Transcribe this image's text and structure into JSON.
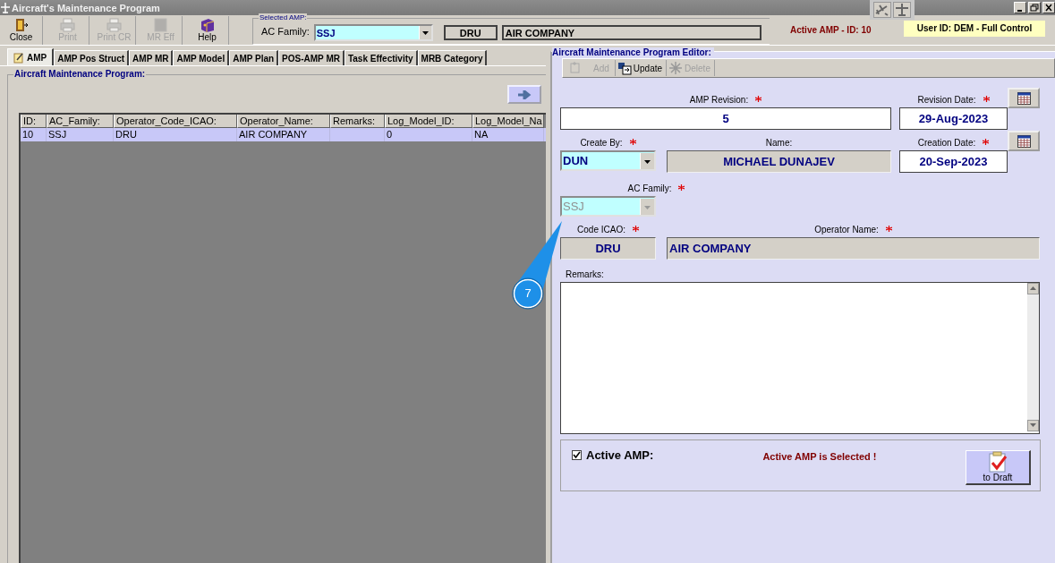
{
  "window": {
    "title": "Aircraft's Maintenance Program"
  },
  "toolbar": [
    {
      "label": "Close",
      "kind": "door",
      "disabled": false
    },
    {
      "label": "Print",
      "kind": "printer",
      "disabled": true
    },
    {
      "label": "Print CR",
      "kind": "printer",
      "disabled": true
    },
    {
      "label": "MR Eff",
      "kind": "square",
      "disabled": true
    },
    {
      "label": "Help",
      "kind": "book",
      "disabled": false
    }
  ],
  "selected_amp": {
    "title": "Selected AMP:",
    "ac_family_label": "AC Family:",
    "ac_family": "SSJ",
    "operator_code": "DRU",
    "operator_name": "AIR COMPANY"
  },
  "active_amp": "Active AMP - ID: 10",
  "user": "User ID: DEM - Full Control",
  "tabs": [
    {
      "label": "AMP",
      "selected": true
    },
    {
      "label": "AMP Pos Struct",
      "selected": false
    },
    {
      "label": "AMP MR",
      "selected": false
    },
    {
      "label": "AMP Model",
      "selected": false
    },
    {
      "label": "AMP Plan",
      "selected": false
    },
    {
      "label": "POS-AMP MR",
      "selected": false
    },
    {
      "label": "Task Effectivity",
      "selected": false
    },
    {
      "label": "MRB Category",
      "selected": false
    }
  ],
  "left_panel": {
    "title": "Aircraft Maintenance Program:",
    "table": {
      "columns": [
        "ID:",
        "AC_Family:",
        "Operator_Code_ICAO:",
        "Operator_Name:",
        "Remarks:",
        "Log_Model_ID:",
        "Log_Model_Na"
      ],
      "rows": [
        {
          "selected": true,
          "cells": [
            "10",
            "SSJ",
            "DRU",
            "AIR COMPANY",
            "",
            "0",
            "NA"
          ]
        }
      ]
    }
  },
  "editor": {
    "title": "Aircraft Maintenance Program Editor:",
    "actions": [
      {
        "label": "Add",
        "kind": "add",
        "disabled": true
      },
      {
        "label": "Update",
        "kind": "update",
        "disabled": false
      },
      {
        "label": "Delete",
        "kind": "delete",
        "disabled": true
      }
    ],
    "amp_revision": {
      "label": "AMP Revision:",
      "required": true,
      "value": "5"
    },
    "revision_date": {
      "label": "Revision Date:",
      "required": true,
      "value": "29-Aug-2023"
    },
    "create_by": {
      "label": "Create By:",
      "required": true,
      "value": "DUN"
    },
    "name": {
      "label": "Name:",
      "required": false,
      "value": "MICHAEL DUNAJEV"
    },
    "creation_date": {
      "label": "Creation Date:",
      "required": true,
      "value": "20-Sep-2023"
    },
    "ac_family": {
      "label": "AC Family:",
      "required": true,
      "value": "SSJ",
      "disabled": true
    },
    "code_icao": {
      "label": "Code ICAO:",
      "required": true,
      "value": "DRU"
    },
    "operator_name": {
      "label": "Operator Name:",
      "required": true,
      "value": "AIR COMPANY"
    },
    "remarks": {
      "label": "Remarks:"
    },
    "active_amp": {
      "label": "Active AMP:",
      "checked": true
    },
    "status": "Active AMP is Selected !",
    "to_draft": {
      "label": "to Draft"
    }
  },
  "callout": {
    "number": "7"
  }
}
